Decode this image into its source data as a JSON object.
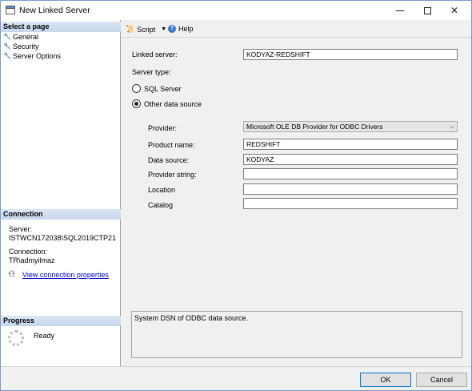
{
  "window": {
    "title": "New Linked Server"
  },
  "left_pane": {
    "select_page_header": "Select a page",
    "pages": [
      {
        "label": "General",
        "icon": "wrench-icon"
      },
      {
        "label": "Security",
        "icon": "wrench-icon"
      },
      {
        "label": "Server Options",
        "icon": "wrench-icon"
      }
    ],
    "connection_header": "Connection",
    "server_label": "Server:",
    "server_value": "ISTWCN172038\\SQL2019CTP21",
    "connection_label": "Connection:",
    "connection_value": "TR\\admyilmaz",
    "view_link": "View connection properties",
    "progress_header": "Progress",
    "progress_status": "Ready"
  },
  "toolbar": {
    "script_label": "Script",
    "help_label": "Help"
  },
  "form": {
    "linked_server_label": "Linked server:",
    "linked_server_value": "KODYAZ-REDSHIFT",
    "server_type_label": "Server type:",
    "radio_sql_server": "SQL Server",
    "radio_other": "Other data source",
    "selected_server_type": "Other data source",
    "provider_label": "Provider:",
    "provider_value": "Microsoft OLE DB Provider for ODBC Drivers",
    "product_name_label": "Product name:",
    "product_name_value": "REDSHIFT",
    "data_source_label": "Data source:",
    "data_source_value": "KODYAZ",
    "provider_string_label": "Provider string:",
    "provider_string_value": "",
    "location_label": "Location",
    "location_value": "",
    "catalog_label": "Catalog",
    "catalog_value": "",
    "description": "System DSN of ODBC data source."
  },
  "footer": {
    "ok_label": "OK",
    "cancel_label": "Cancel"
  }
}
